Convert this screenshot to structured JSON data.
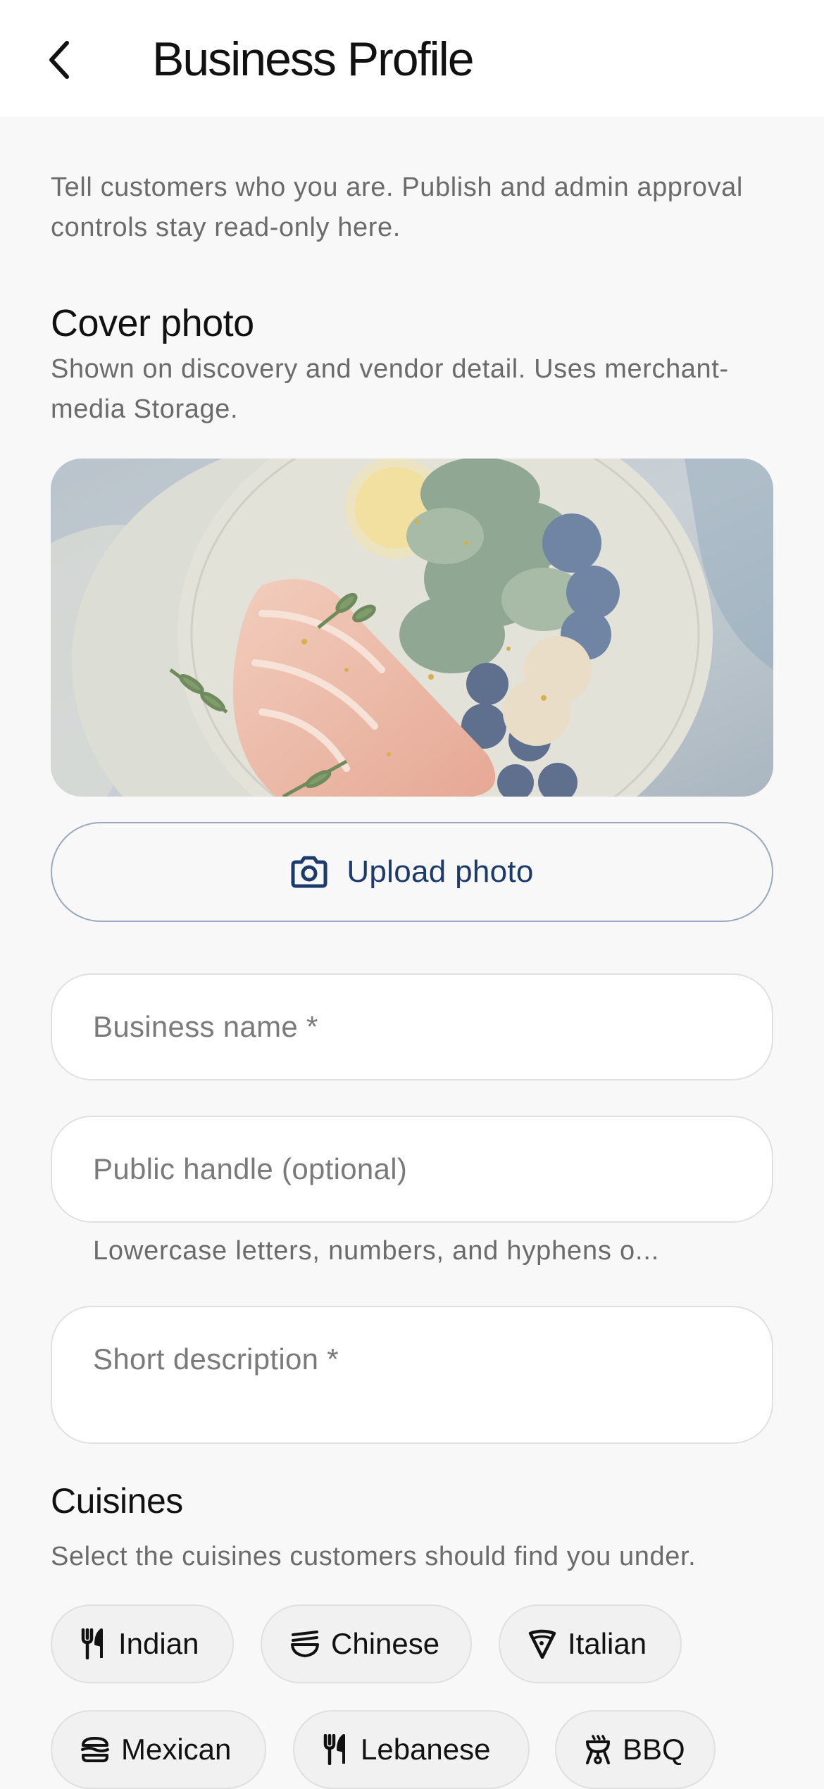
{
  "header": {
    "title": "Business Profile"
  },
  "intro": "Tell customers who you are. Publish and admin approval controls stay read-only here.",
  "cover": {
    "title": "Cover photo",
    "subtitle": "Shown on discovery and vendor detail. Uses merchant-media Storage.",
    "upload_label": "Upload photo"
  },
  "form": {
    "business_name": {
      "placeholder": "Business name *",
      "value": ""
    },
    "public_handle": {
      "placeholder": "Public handle (optional)",
      "value": "",
      "helper": "Lowercase letters, numbers, and hyphens o..."
    },
    "description": {
      "placeholder": "Short description *",
      "value": ""
    }
  },
  "cuisines": {
    "title": "Cuisines",
    "subtitle": "Select the cuisines customers should find you under.",
    "items": [
      {
        "label": "Indian",
        "icon": "utensils-icon"
      },
      {
        "label": "Chinese",
        "icon": "noodle-bowl-icon"
      },
      {
        "label": "Italian",
        "icon": "pizza-slice-icon"
      },
      {
        "label": "Mexican",
        "icon": "burrito-icon"
      },
      {
        "label": "Lebanese",
        "icon": "utensils-icon"
      },
      {
        "label": "BBQ",
        "icon": "grill-icon"
      }
    ]
  },
  "colors": {
    "accent": "#1c3a6b",
    "background": "#f8f8f8",
    "muted_text": "#6b6b6b"
  }
}
